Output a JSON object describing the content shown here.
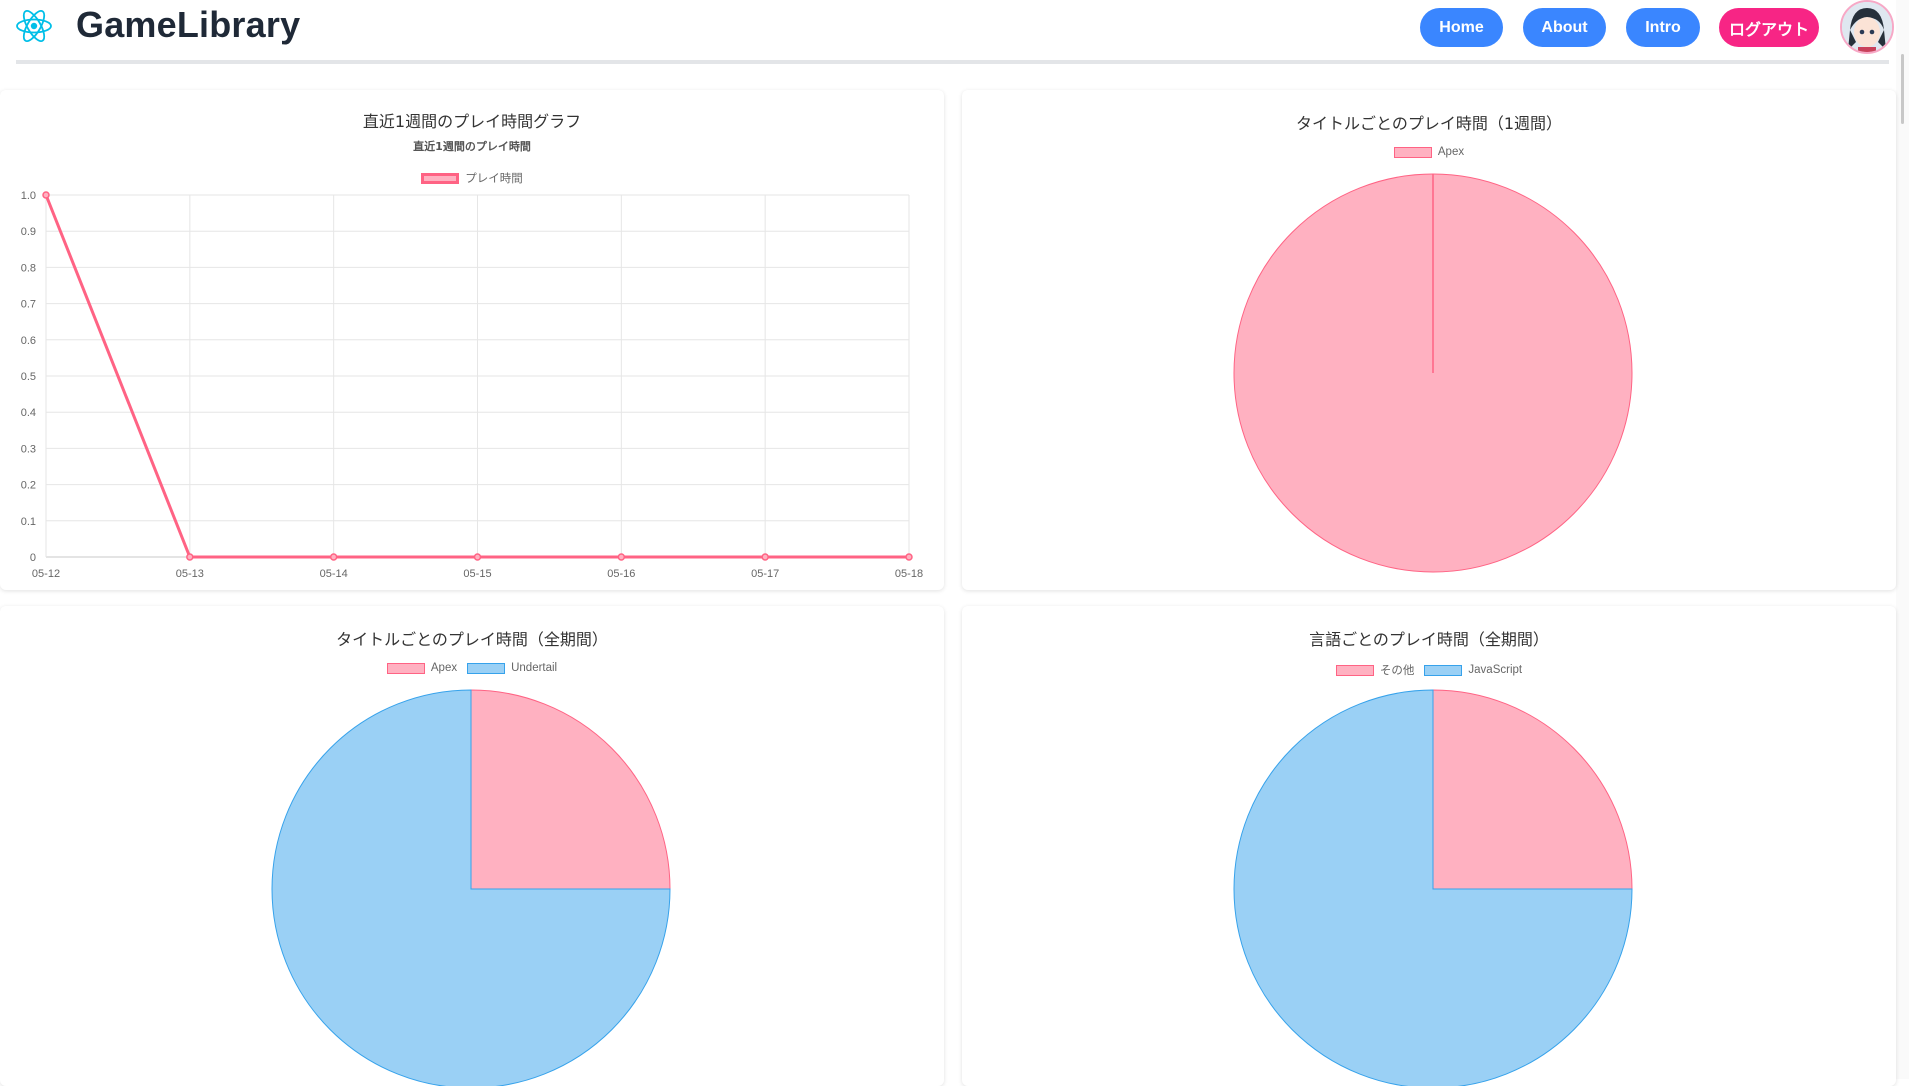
{
  "header": {
    "brand": "GameLibrary",
    "logo_icon": "react-atom-icon",
    "nav": [
      {
        "label": "Home",
        "color": "#3a86ff"
      },
      {
        "label": "About",
        "color": "#3a86ff"
      },
      {
        "label": "Intro",
        "color": "#3a86ff"
      },
      {
        "label": "ログアウト",
        "color": "#f72585"
      }
    ]
  },
  "cards": {
    "weekly_line": {
      "title": "直近1週間のプレイ時間グラフ",
      "legend": [
        "プレイ時間"
      ]
    },
    "title_week_pie": {
      "title": "タイトルごとのプレイ時間（1週間）",
      "legend": [
        "Apex"
      ]
    },
    "title_all_pie": {
      "title": "タイトルごとのプレイ時間（全期間）",
      "legend": [
        "Apex",
        "Undertail"
      ]
    },
    "lang_all_pie": {
      "title": "言語ごとのプレイ時間（全期間）",
      "legend": [
        "その他",
        "JavaScript"
      ]
    }
  },
  "chart_data": [
    {
      "type": "line",
      "title": "直近1週間のプレイ時間",
      "x": [
        "05-12",
        "05-13",
        "05-14",
        "05-15",
        "05-16",
        "05-17",
        "05-18"
      ],
      "series": [
        {
          "name": "プレイ時間",
          "values": [
            1,
            0,
            0,
            0,
            0,
            0,
            0
          ],
          "color": "#ff6384"
        }
      ],
      "yticks": [
        "0",
        "0.1",
        "0.2",
        "0.3",
        "0.4",
        "0.5",
        "0.6",
        "0.7",
        "0.8",
        "0.9",
        "1.0"
      ],
      "ylim": [
        0,
        1
      ],
      "grid": true,
      "legend_position": "top"
    },
    {
      "type": "pie",
      "categories": [
        "Apex"
      ],
      "values": [
        1
      ],
      "colors": [
        "#ffb1c1"
      ],
      "border_colors": [
        "#ff6384"
      ]
    },
    {
      "type": "pie",
      "categories": [
        "Apex",
        "Undertail"
      ],
      "values": [
        25,
        75
      ],
      "colors": [
        "#ffb1c1",
        "#9ad0f5"
      ],
      "border_colors": [
        "#ff6384",
        "#36a2eb"
      ]
    },
    {
      "type": "pie",
      "categories": [
        "その他",
        "JavaScript"
      ],
      "values": [
        25,
        75
      ],
      "colors": [
        "#ffb1c1",
        "#9ad0f5"
      ],
      "border_colors": [
        "#ff6384",
        "#36a2eb"
      ]
    }
  ]
}
